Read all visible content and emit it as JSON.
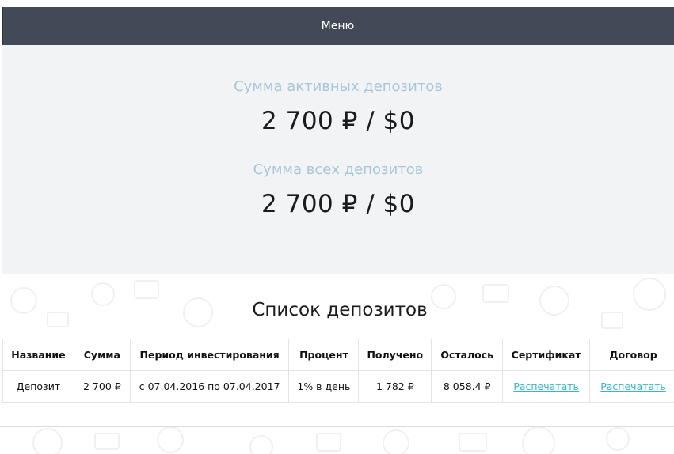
{
  "menu": {
    "label": "Меню"
  },
  "summary": {
    "active_label": "Сумма активных депозитов",
    "active_value": "2 700 ₽ / $0",
    "total_label": "Сумма всех депозитов",
    "total_value": "2 700 ₽ / $0"
  },
  "deposits": {
    "title": "Список депозитов",
    "columns": [
      "Название",
      "Сумма",
      "Период инвестирования",
      "Процент",
      "Получено",
      "Осталось",
      "Сертификат",
      "Договор"
    ],
    "rows": [
      {
        "name": "Депозит",
        "amount": "2 700 ₽",
        "period": "с 07.04.2016 по 07.04.2017",
        "percent": "1% в день",
        "received": "1 782 ₽",
        "remaining": "8 058.4 ₽",
        "certificate": "Распечатать",
        "contract": "Распечатать"
      }
    ]
  },
  "colors": {
    "menu_bg": "#414a56",
    "summary_bg": "#f1f3f5",
    "label": "#a9c6d9",
    "link": "#35b7cf"
  },
  "background_pattern": "money-doodle-icons"
}
